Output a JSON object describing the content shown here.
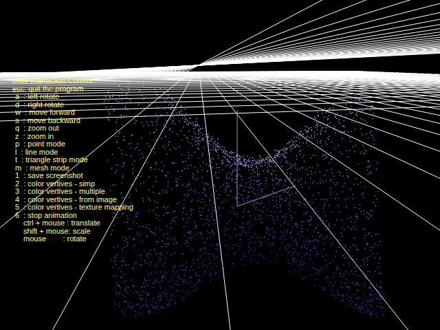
{
  "overlay": {
    "title": "User Interaction Control",
    "lines": [
      {
        "text": "esc: quit the program",
        "kind": "header"
      },
      {
        "text": "a  : left rotate",
        "kind": "key"
      },
      {
        "text": "d  : right rotate",
        "kind": "key"
      },
      {
        "text": "w  : move forward",
        "kind": "key"
      },
      {
        "text": "s  : move backward",
        "kind": "key"
      },
      {
        "text": "q  : zoom out",
        "kind": "key"
      },
      {
        "text": "z  : zoom in",
        "kind": "key"
      },
      {
        "text": "p  : point mode",
        "kind": "key"
      },
      {
        "text": "l  : line mode",
        "kind": "key"
      },
      {
        "text": "t  : triangle strip mode",
        "kind": "key"
      },
      {
        "text": "m  : mesh mode",
        "kind": "key"
      },
      {
        "text": "1  : save screenshot",
        "kind": "key"
      },
      {
        "text": "2  : color vertives - simp",
        "kind": "key"
      },
      {
        "text": "3  : color vertives - multiple",
        "kind": "key"
      },
      {
        "text": "4  : color vertives - from image",
        "kind": "key"
      },
      {
        "text": "5  : color vertives - texture mapping",
        "kind": "key"
      },
      {
        "text": "6  : stop animation",
        "kind": "key"
      },
      {
        "text": "ctrl + mouse : translate",
        "kind": "mouse"
      },
      {
        "text": "shift + mouse: scale",
        "kind": "mouse"
      },
      {
        "text": "mouse        : rotate",
        "kind": "mouse"
      }
    ]
  }
}
